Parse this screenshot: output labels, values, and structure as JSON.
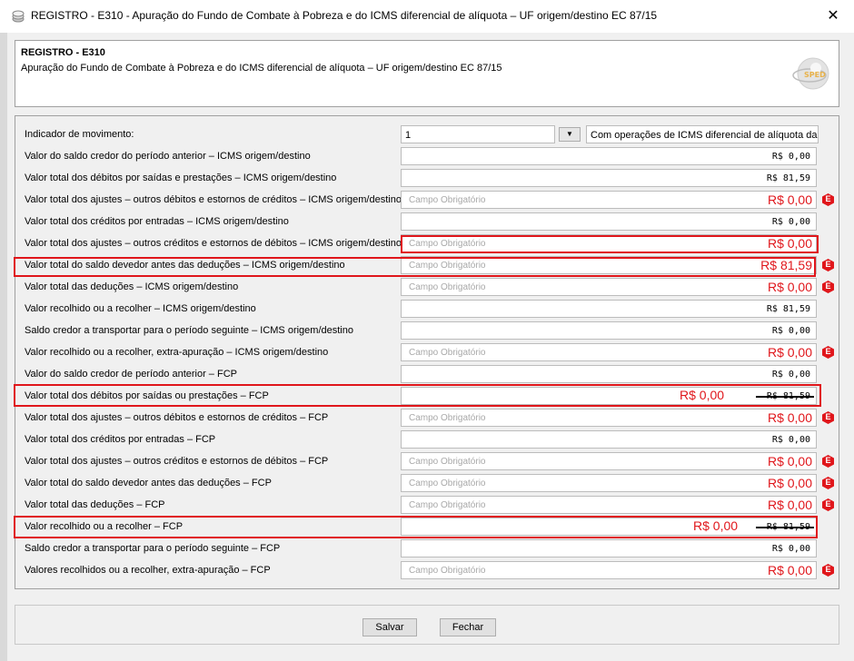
{
  "window": {
    "title": "REGISTRO - E310 - Apuração do Fundo de Combate à Pobreza e do ICMS diferencial de alíquota – UF origem/destino EC 87/15",
    "close_glyph": "✕",
    "app_icon": "app-icon"
  },
  "header": {
    "registro": "REGISTRO - E310",
    "descricao": "Apuração do Fundo de Combate à Pobreza e do ICMS diferencial de alíquota – UF origem/destino EC 87/15",
    "logo_text": "SPED",
    "logo_icon": "sped-logo-icon"
  },
  "indicador": {
    "label": "Indicador de movimento:",
    "value": "1",
    "dropdown_glyph": "▼",
    "descricao": "Com operações de ICMS diferencial de alíquota da UF"
  },
  "placeholder": "Campo Obrigatório",
  "error_glyph": "E",
  "colors": {
    "error": "#e0161b",
    "highlight_box": "#e0161b"
  },
  "rows": [
    {
      "label": "Valor do saldo credor do período anterior – ICMS origem/destino",
      "value": "R$ 0,00"
    },
    {
      "label": "Valor total dos débitos por saídas e prestações – ICMS origem/destino",
      "value": "R$ 81,59"
    },
    {
      "label": "Valor total dos ajustes – outros débitos e estornos de créditos – ICMS origem/destino",
      "red_value": "R$ 0,00"
    },
    {
      "label": "Valor total dos créditos por entradas – ICMS origem/destino",
      "value": "R$ 0,00"
    },
    {
      "label": "Valor total dos ajustes – outros créditos e estornos de débitos – ICMS origem/destino",
      "red_value": "R$ 0,00"
    },
    {
      "label": "Valor total do saldo devedor antes das deduções – ICMS origem/destino",
      "red_value": "R$ 81,59"
    },
    {
      "label": "Valor total das deduções – ICMS origem/destino",
      "red_value": "R$ 0,00"
    },
    {
      "label": "Valor recolhido ou a recolher – ICMS origem/destino",
      "value": "R$ 81,59"
    },
    {
      "label": "Saldo credor a transportar para o período seguinte – ICMS origem/destino",
      "value": "R$ 0,00"
    },
    {
      "label": "Valor recolhido ou a recolher, extra-apuração – ICMS origem/destino",
      "red_value": "R$ 0,00"
    },
    {
      "label": "Valor do saldo credor de período anterior – FCP",
      "value": "R$ 0,00"
    },
    {
      "label": "Valor total dos débitos por saídas ou prestações – FCP",
      "red_value": "R$ 0,00",
      "struck_value": "R$ 81,59"
    },
    {
      "label": "Valor total dos ajustes – outros débitos e estornos de créditos – FCP",
      "red_value": "R$ 0,00"
    },
    {
      "label": "Valor total dos créditos por entradas – FCP",
      "value": "R$ 0,00"
    },
    {
      "label": "Valor total dos ajustes – outros créditos e estornos de débitos – FCP",
      "red_value": "R$ 0,00"
    },
    {
      "label": "Valor total do saldo devedor antes das deduções – FCP",
      "red_value": "R$ 0,00"
    },
    {
      "label": "Valor total das deduções – FCP",
      "red_value": "R$ 0,00"
    },
    {
      "label": "Valor recolhido ou a recolher – FCP",
      "red_value": "R$ 0,00",
      "struck_value": "R$ 81,59"
    },
    {
      "label": "Saldo credor a transportar para o período seguinte – FCP",
      "value": "R$ 0,00"
    },
    {
      "label": "Valores recolhidos ou a recolher, extra-apuração – FCP",
      "red_value": "R$ 0,00"
    }
  ],
  "buttons": {
    "save": "Salvar",
    "close": "Fechar"
  }
}
